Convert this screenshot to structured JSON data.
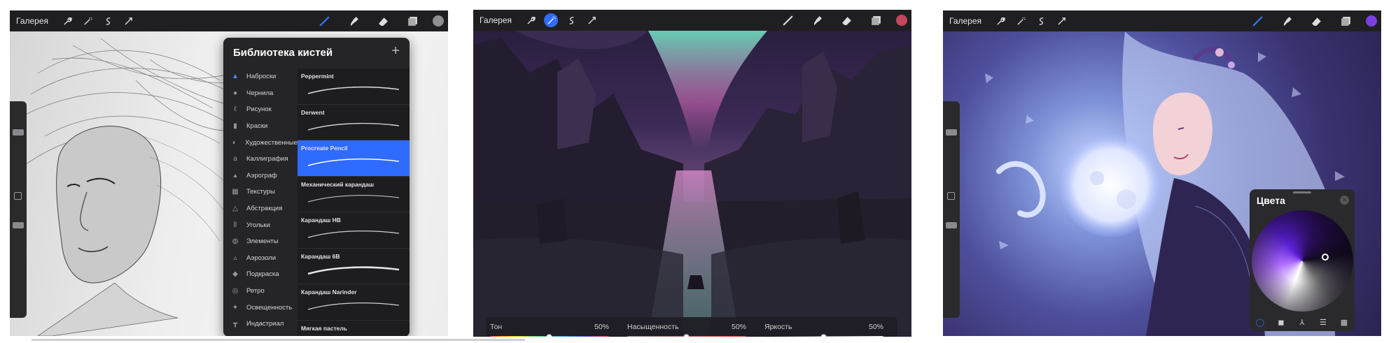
{
  "screens": [
    {
      "gallery": "Галерея",
      "color_swatch": "#8e8e93",
      "brush_library": {
        "title": "Библиотека кистей",
        "add": "+",
        "categories": [
          {
            "label": "Наброски",
            "icon": "▲"
          },
          {
            "label": "Чернила",
            "icon": "●"
          },
          {
            "label": "Рисунок",
            "icon": "ℓ"
          },
          {
            "label": "Краски",
            "icon": "▮"
          },
          {
            "label": "Художественные",
            "icon": "◐"
          },
          {
            "label": "Каллиграфия",
            "icon": "a"
          },
          {
            "label": "Аэрограф",
            "icon": "▴"
          },
          {
            "label": "Текстуры",
            "icon": "▦"
          },
          {
            "label": "Абстракция",
            "icon": "△"
          },
          {
            "label": "Угольки",
            "icon": "⦀"
          },
          {
            "label": "Элементы",
            "icon": "◍"
          },
          {
            "label": "Аэрозоли",
            "icon": "▵"
          },
          {
            "label": "Подкраска",
            "icon": "◆"
          },
          {
            "label": "Ретро",
            "icon": "◎"
          },
          {
            "label": "Освещенность",
            "icon": "✦"
          },
          {
            "label": "Индастриал",
            "icon": "┳"
          }
        ],
        "brushes": [
          "Peppermint",
          "Derwent",
          "Procreate Pencil",
          "Механический карандаш",
          "Карандаш HB",
          "Карандаш 6B",
          "Карандаш Narinder",
          "Мягкая пастель"
        ]
      }
    },
    {
      "gallery": "Галерея",
      "color_swatch": "#c2465c",
      "hsb": [
        {
          "label": "Тон",
          "value": "50%"
        },
        {
          "label": "Насыщенность",
          "value": "50%"
        },
        {
          "label": "Яркость",
          "value": "50%"
        }
      ]
    },
    {
      "gallery": "Галерея",
      "color_swatch": "#7b3fe0",
      "colors_panel": {
        "title": "Цвета",
        "close": "×"
      }
    }
  ]
}
